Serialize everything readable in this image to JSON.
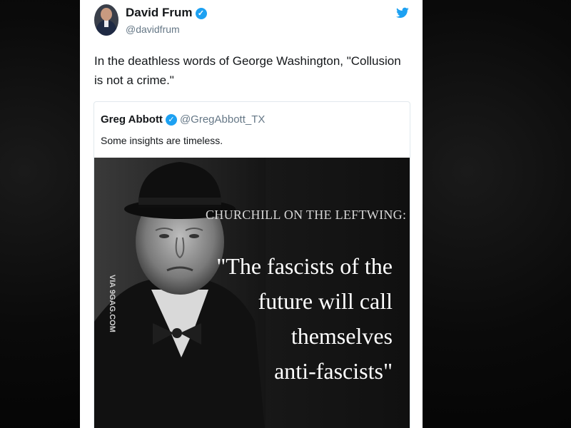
{
  "tweet": {
    "author_name": "David Frum",
    "author_handle": "@davidfrum",
    "verified_mark": "✓",
    "text": "In the deathless words of George Washington, \"Collusion is not a crime.\""
  },
  "quoted_tweet": {
    "author_name": "Greg Abbott",
    "author_handle": "@GregAbbott_TX",
    "verified_mark": "✓",
    "text": "Some insights are timeless.",
    "image": {
      "heading": "CHURCHILL ON THE LEFTWING:",
      "quote_lines": [
        "\"The fascists of the",
        "future will call",
        "themselves",
        "anti-fascists\""
      ],
      "watermark": "VIA 9GAG.COM"
    }
  },
  "icons": {
    "twitter_bird": "twitter-bird-icon",
    "verified_badge": "verified-badge-icon"
  },
  "colors": {
    "twitter_blue": "#1da1f2",
    "handle_gray": "#657786",
    "text_dark": "#14171a"
  }
}
